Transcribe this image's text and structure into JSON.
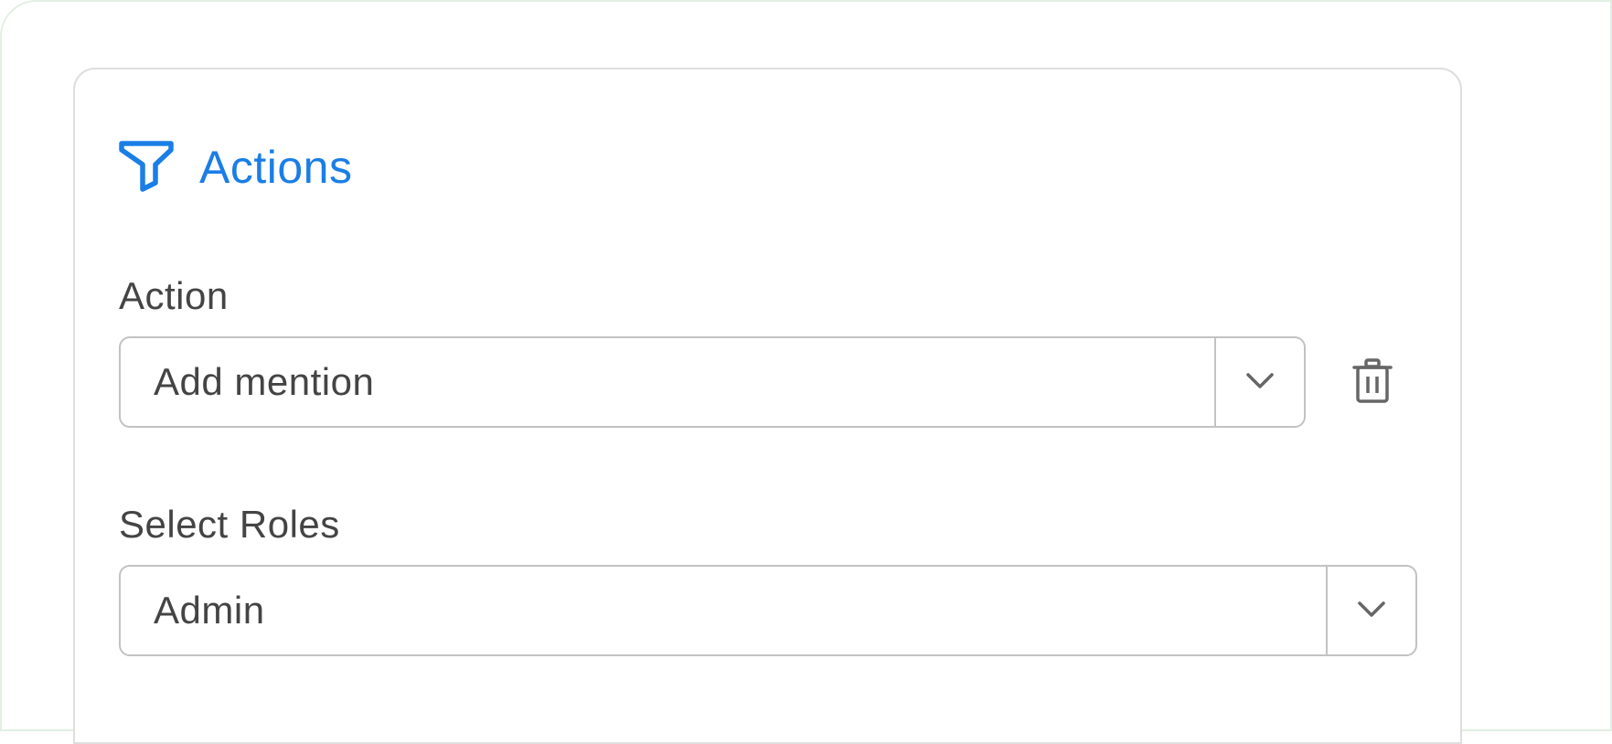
{
  "header": {
    "title": "Actions",
    "icon": "filter-icon",
    "accent_color": "#1a7ee6"
  },
  "action_field": {
    "label": "Action",
    "selected_value": "Add mention",
    "toggle_icon": "chevron-down-icon",
    "delete_icon": "trash-icon"
  },
  "roles_field": {
    "label": "Select Roles",
    "selected_value": "Admin",
    "toggle_icon": "chevron-down-icon"
  }
}
